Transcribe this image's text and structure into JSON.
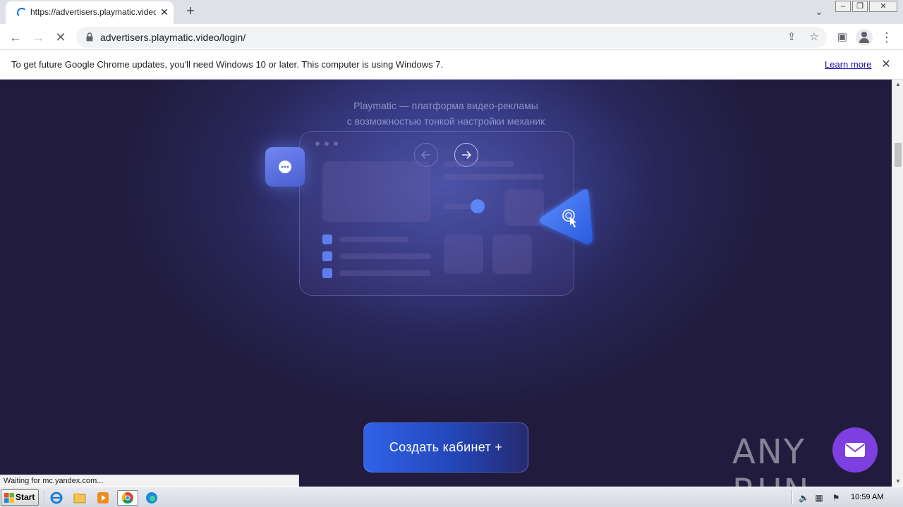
{
  "browser": {
    "tab": {
      "title": "https://advertisers.playmatic.video/"
    },
    "new_tab_symbol": "+",
    "address": {
      "url": "advertisers.playmatic.video/login/"
    },
    "window_controls": [
      "minimize",
      "restore",
      "close"
    ]
  },
  "infobar": {
    "message": "To get future Google Chrome updates, you'll need Windows 10 or later. This computer is using Windows 7.",
    "link": "Learn more"
  },
  "page": {
    "tagline_line1": "Playmatic — платформа видео-рекламы",
    "tagline_line2": "с возможностью тонкой настройки механик",
    "create_button": "Создать кабинет +",
    "watermark": "ANY RUN",
    "colors": {
      "background": "#211c3d",
      "accent": "#2f63e8",
      "mail": "#7e3fe0"
    }
  },
  "status_bar": {
    "text": "Waiting for mc.yandex.com..."
  },
  "taskbar": {
    "start_label": "Start",
    "clock": "10:59 AM",
    "apps": [
      "ie-icon",
      "explorer-icon",
      "media-player-icon",
      "chrome-icon",
      "edge-icon"
    ]
  }
}
